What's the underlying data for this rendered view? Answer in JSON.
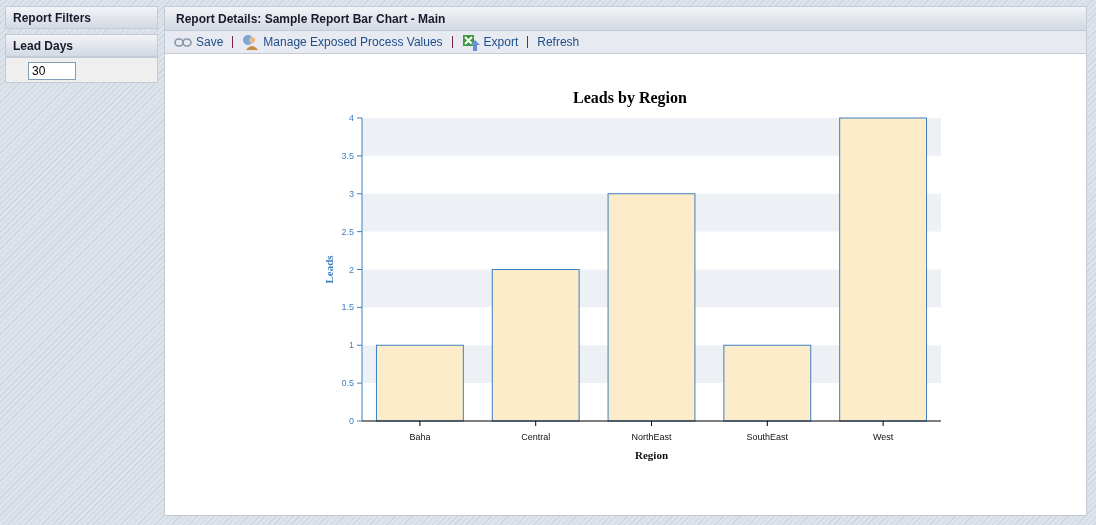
{
  "sidebar": {
    "title": "Report Filters",
    "filters": [
      {
        "label": "Lead Days",
        "value": "30"
      }
    ]
  },
  "report": {
    "title": "Report Details: Sample Report Bar Chart - Main",
    "toolbar": [
      {
        "kind": "save",
        "label": "Save"
      },
      {
        "kind": "manage",
        "label": "Manage Exposed Process Values"
      },
      {
        "kind": "export",
        "label": "Export"
      },
      {
        "kind": "refresh",
        "label": "Refresh"
      }
    ],
    "chart_data": {
      "type": "bar",
      "title": "Leads by Region",
      "xlabel": "Region",
      "ylabel": "Leads",
      "categories": [
        "Baha",
        "Central",
        "NorthEast",
        "SouthEast",
        "West"
      ],
      "series": [
        {
          "color": "#fcecc9",
          "values": [
            1,
            2,
            3,
            1,
            4
          ]
        }
      ],
      "ylim": [
        0,
        4
      ],
      "yticks": [
        0,
        0.5,
        1,
        1.5,
        2,
        2.5,
        3,
        3.5,
        4
      ]
    }
  }
}
